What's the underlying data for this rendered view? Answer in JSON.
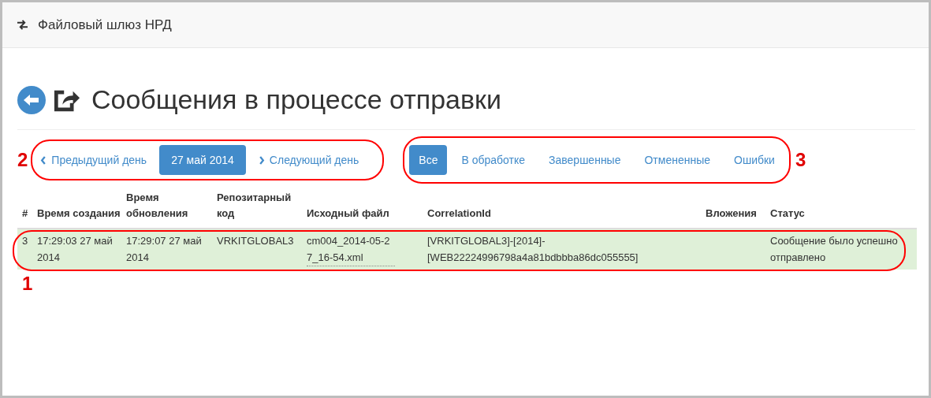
{
  "navbar": {
    "brand": "Файловый шлюз НРД"
  },
  "page": {
    "title": "Сообщения в процессе отправки"
  },
  "day_nav": {
    "previous": "Предыдущий день",
    "date": "27 май 2014",
    "next": "Следующий день"
  },
  "filters": [
    {
      "label": "Все",
      "selected": true
    },
    {
      "label": "В обработке",
      "selected": false
    },
    {
      "label": "Завершенные",
      "selected": false
    },
    {
      "label": "Отмененные",
      "selected": false
    },
    {
      "label": "Ошибки",
      "selected": false
    }
  ],
  "table": {
    "columns": [
      "#",
      "Время создания",
      "Время обновления",
      "Репозитарный код",
      "Исходный файл",
      "CorrelationId",
      "Вложения",
      "Статус"
    ],
    "rows": [
      {
        "number": "3",
        "created": "17:29:03 27 май 2014",
        "updated": "17:29:07 27 май 2014",
        "repo_code": "VRKITGLOBAL3",
        "source_file": "cm004_2014-05-27_16-54.xml",
        "correlation_id": "[VRKITGLOBAL3]-[2014]-[WEB22224996798a4a81bdbbba86dc055555]",
        "status": "Сообщение было успешно отправлено",
        "success": true
      }
    ]
  },
  "callouts": [
    "1",
    "2",
    "3"
  ]
}
